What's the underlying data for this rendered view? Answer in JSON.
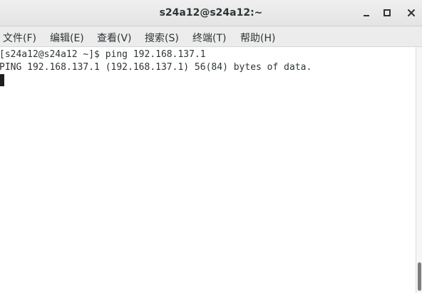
{
  "window": {
    "title": "s24a12@s24a12:~",
    "controls": [
      {
        "icon": "minimize-icon"
      },
      {
        "icon": "maximize-icon"
      },
      {
        "icon": "close-icon"
      }
    ]
  },
  "menubar": {
    "items": [
      {
        "label": "文件(F)"
      },
      {
        "label": "编辑(E)"
      },
      {
        "label": "查看(V)"
      },
      {
        "label": "搜索(S)"
      },
      {
        "label": "终端(T)"
      },
      {
        "label": "帮助(H)"
      }
    ]
  },
  "terminal": {
    "lines": [
      "[s24a12@s24a12 ~]$ ping 192.168.137.1",
      "PING 192.168.137.1 (192.168.137.1) 56(84) bytes of data."
    ]
  }
}
